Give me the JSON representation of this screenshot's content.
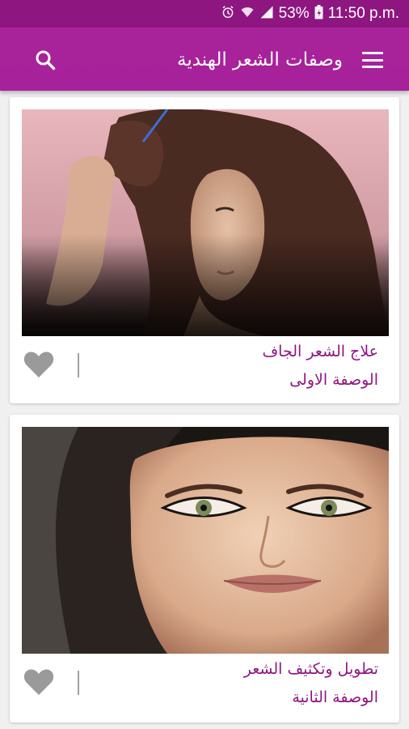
{
  "status_bar": {
    "battery": "53%",
    "time": "11:50 p.m."
  },
  "app_bar": {
    "title": "وصفات الشعر الهندية",
    "icons": {
      "menu": "menu-icon",
      "search": "search-icon"
    }
  },
  "recipes": [
    {
      "title": "علاج الشعر الجاف",
      "subtitle": "الوصفة الاولى",
      "image": "woman-with-dry-hair-photo"
    },
    {
      "title": "تطويل وتكثيف الشعر",
      "subtitle": "الوصفة الثانية",
      "image": "woman-face-closeup-photo"
    }
  ],
  "colors": {
    "status_bar": "#8e1681",
    "app_bar": "#a7229a",
    "accent_text": "#8e1681",
    "heart": "#9a9a9a"
  }
}
